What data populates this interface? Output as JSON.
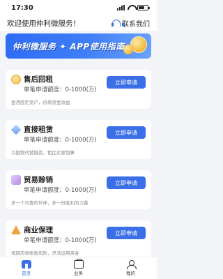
{
  "status_bar": {
    "time": "17:30"
  },
  "header": {
    "welcome": "欢迎使用仲利微服务！",
    "contact_label": "联系我们"
  },
  "banner": {
    "title": "仲利微服务 ✦ APP使用指南"
  },
  "cards": [
    {
      "title": "售后回租",
      "limit": "单笔申请额度：0-1000(万)",
      "desc": "盘活固定资产，倍增资金效益",
      "button": "立即申请",
      "icon": "coin-icon"
    },
    {
      "title": "直接租赁",
      "limit": "单笔申请额度：0-1000(万)",
      "desc": "以融物代替融资，租比买更划算",
      "button": "立即申请",
      "icon": "diamond-icon"
    },
    {
      "title": "贸易赊销",
      "limit": "单笔申请额度：0-1000(万)",
      "desc": "多一个可靠的伙伴，多一份胜利的力量",
      "button": "立即申请",
      "icon": "cube-icon"
    },
    {
      "title": "商业保理",
      "limit": "单笔申请额度：0-1000(万)",
      "desc": "规避应收账款风险，灵活运用资金",
      "button": "立即申请",
      "icon": "triangle-icon"
    }
  ],
  "tabbar": {
    "items": [
      "首页",
      "业务",
      "我的"
    ],
    "active": "首页"
  },
  "colors": {
    "accent": "#3b6fe8",
    "background": "#f3f4f8"
  }
}
